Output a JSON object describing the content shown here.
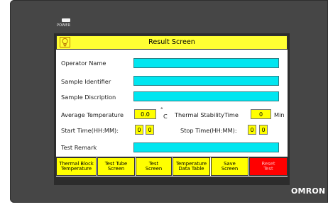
{
  "device": {
    "power_label": "POWER",
    "brand": "OMRON",
    "colors": {
      "bezel": "#464646",
      "title_bar": "#ffff33",
      "field": "#00e6f0",
      "value_box": "#ffff00",
      "reset": "#ff0000"
    }
  },
  "screen": {
    "title": "Result Screen",
    "title_icon": "lightbulb-icon"
  },
  "form": {
    "operator_name": {
      "label": "Operator Name",
      "value": ""
    },
    "sample_identifier": {
      "label": "Sample Identifier",
      "value": ""
    },
    "sample_description": {
      "label": "Sample Discription",
      "value": ""
    },
    "average_temperature": {
      "label": "Average Temperature",
      "value": "0.0",
      "unit_symbol": "°",
      "unit_letter": "C"
    },
    "thermal_stability_time": {
      "label": "Thermal StabilityTime",
      "value": "0",
      "unit": "Min"
    },
    "start_time": {
      "label": "Start Time(HH:MM):",
      "hours": "0",
      "minutes": "0"
    },
    "stop_time": {
      "label": "Stop Time(HH:MM):",
      "hours": "0",
      "minutes": "0"
    },
    "test_remark": {
      "label": "Test Remark",
      "value": ""
    }
  },
  "nav": {
    "thermal_block": "Thermal Block\nTemperature",
    "test_tube": "Test Tube\nScreen",
    "test_screen": "Test\nScreen",
    "temp_table": "Temperature\nData Table",
    "save_screen": "Save\nScreen",
    "reset_test": "Reset\nTest"
  }
}
